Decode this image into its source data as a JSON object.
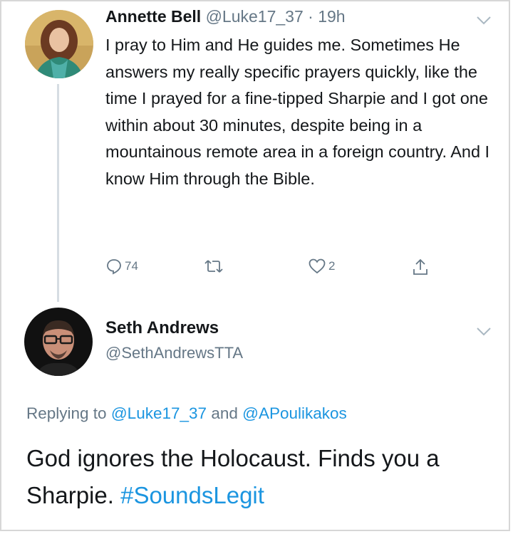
{
  "tweet": {
    "author_name": "Annette Bell",
    "author_handle": "@Luke17_37",
    "separator": "·",
    "time": "19h",
    "text": "I pray to Him and He guides me. Sometimes He answers my really specific prayers quickly, like the time I prayed for a fine-tipped Sharpie and I got one within about 30 minutes, despite being in a mountainous remote area in a foreign country. And I know Him through the Bible.",
    "actions": {
      "reply_count": "74",
      "retweet_count": "",
      "like_count": "2",
      "icons": [
        "reply-icon",
        "retweet-icon",
        "like-icon",
        "share-icon"
      ]
    }
  },
  "reply": {
    "author_name": "Seth Andrews",
    "author_handle": "@SethAndrewsTTA",
    "replying_prefix": "Replying to",
    "replying_user_1": "@Luke17_37",
    "replying_and": "and",
    "replying_user_2": "@APoulikakos",
    "text_main": "God ignores the Holocaust. Finds you a Sharpie.",
    "hashtag": "#SoundsLegit"
  },
  "colors": {
    "text": "#14171a",
    "secondary": "#657786",
    "link": "#1b95e0",
    "thread_line": "#d6dde3"
  }
}
